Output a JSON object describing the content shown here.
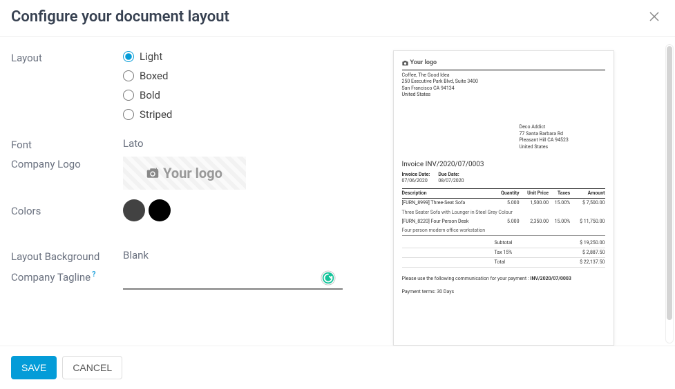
{
  "header": {
    "title": "Configure your document layout"
  },
  "form": {
    "layout": {
      "label": "Layout",
      "options": [
        "Light",
        "Boxed",
        "Bold",
        "Striped"
      ],
      "selected": "Light"
    },
    "font": {
      "label": "Font",
      "value": "Lato"
    },
    "logo": {
      "label": "Company Logo",
      "placeholder": "Your logo"
    },
    "colors": {
      "label": "Colors",
      "swatches": [
        {
          "name": "dark-grey",
          "hex": "#424242"
        },
        {
          "name": "black",
          "hex": "#000000"
        }
      ]
    },
    "background": {
      "label": "Layout Background",
      "value": "Blank"
    },
    "tagline": {
      "label": "Company Tagline",
      "value": ""
    }
  },
  "preview": {
    "logo_text": "Your logo",
    "company": {
      "lines": [
        "Coffee, The Good Idea",
        "250 Executive Park Blvd, Suite 3400",
        "San Francisco CA 94134",
        "United States"
      ]
    },
    "bill_to": {
      "lines": [
        "Deco Addict",
        "77 Santa Barbara Rd",
        "Pleasant Hill CA 94523",
        "United States"
      ]
    },
    "invoice_title": "Invoice INV/2020/07/0003",
    "dates": {
      "invoice_label": "Invoice Date:",
      "invoice_value": "07/06/2020",
      "due_label": "Due Date:",
      "due_value": "08/07/2020"
    },
    "columns": [
      "Description",
      "Quantity",
      "Unit Price",
      "Taxes",
      "Amount"
    ],
    "lines": [
      {
        "sku": "[FURN_8999] Three-Seat Sofa",
        "sub": "Three Seater Sofa with Lounger in Steel Grey Colour",
        "qty": "5.000",
        "price": "1,500.00",
        "tax": "15.00%",
        "amount": "$ 7,500.00"
      },
      {
        "sku": "[FURN_8220] Four Person Desk",
        "sub": "Four person modern office workstation",
        "qty": "5.000",
        "price": "2,350.00",
        "tax": "15.00%",
        "amount": "$ 11,750.00"
      }
    ],
    "totals": {
      "subtotal_label": "Subtotal",
      "subtotal": "$ 19,250.00",
      "tax_label": "Tax 15%",
      "tax": "$ 2,887.50",
      "total_label": "Total",
      "total": "$ 22,137.50"
    },
    "payment_note": "Please use the following communication for your payment : ",
    "payment_ref": "INV/2020/07/0003",
    "terms": "Payment terms: 30 Days"
  },
  "footer": {
    "save": "SAVE",
    "cancel": "CANCEL"
  }
}
